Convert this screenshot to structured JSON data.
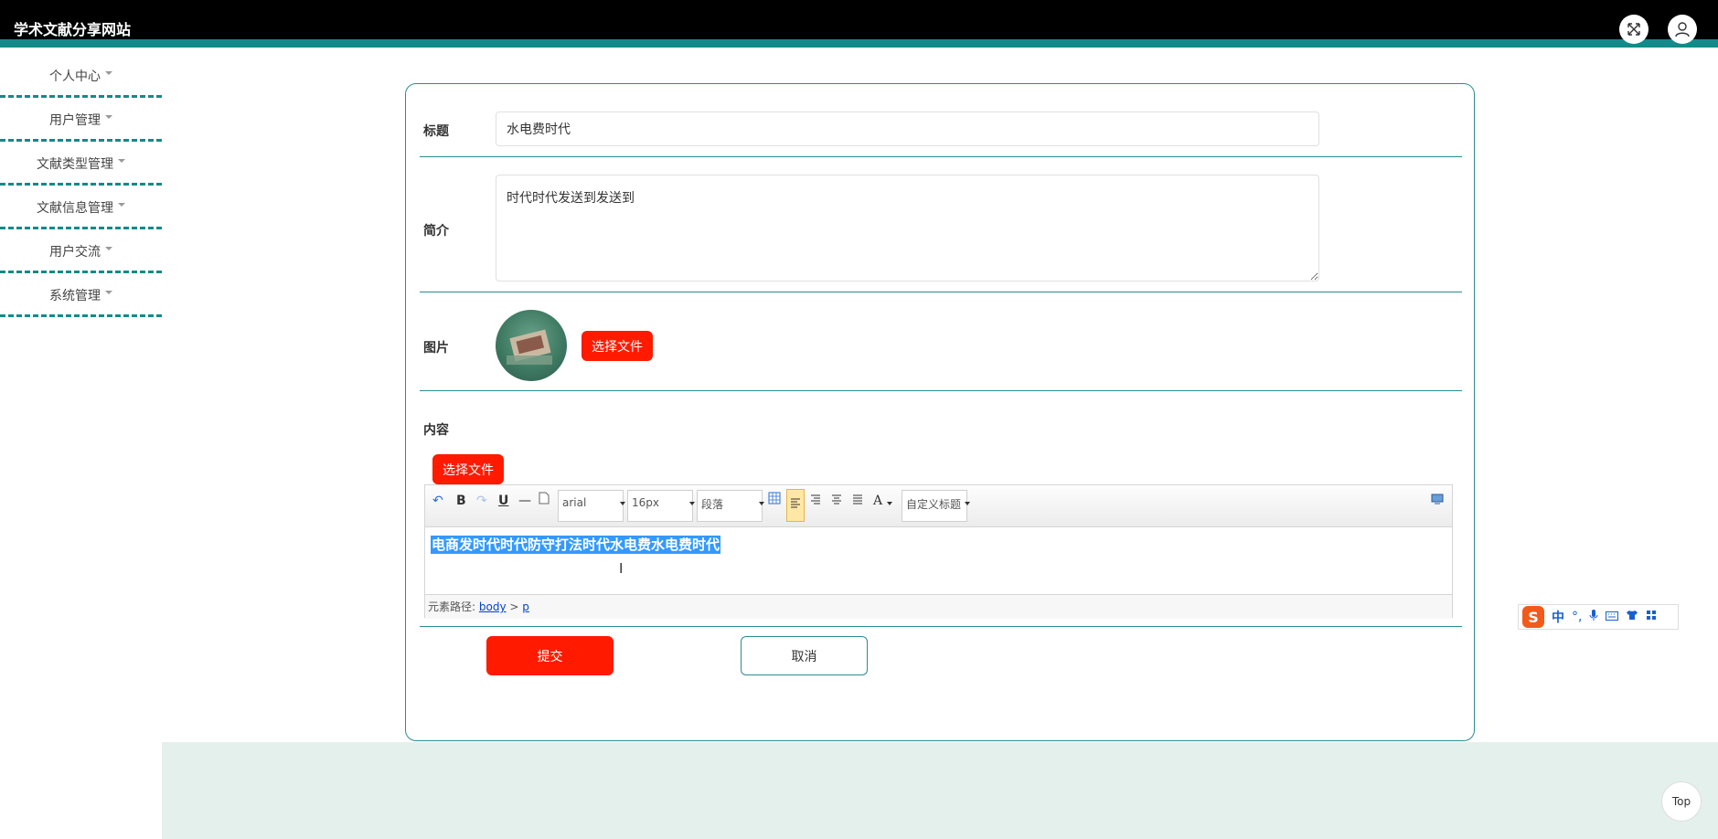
{
  "header": {
    "title": "学术文献分享网站"
  },
  "sidebar": {
    "items": [
      {
        "label": "个人中心"
      },
      {
        "label": "用户管理"
      },
      {
        "label": "文献类型管理"
      },
      {
        "label": "文献信息管理"
      },
      {
        "label": "用户交流"
      },
      {
        "label": "系统管理"
      }
    ]
  },
  "form": {
    "title_label": "标题",
    "title_value": "水电费时代",
    "intro_label": "简介",
    "intro_value": "时代时代发送到发送到",
    "image_label": "图片",
    "choose_file": "选择文件",
    "content_label": "内容",
    "content_choose_file": "选择文件",
    "submit": "提交",
    "cancel": "取消"
  },
  "editor": {
    "toolbar": {
      "bold": "B",
      "underline": "U",
      "font_family": "arial",
      "font_size": "16px",
      "paragraph": "段落",
      "font_color": "A",
      "custom_title": "自定义标题"
    },
    "content_text": "电商发时代时代防守打法时代水电费水电费时代",
    "path_label": "元素路径:",
    "path_body": "body",
    "path_sep": ">",
    "path_p": "p"
  },
  "ime": {
    "lang": "中"
  },
  "scroll_top": "Top"
}
